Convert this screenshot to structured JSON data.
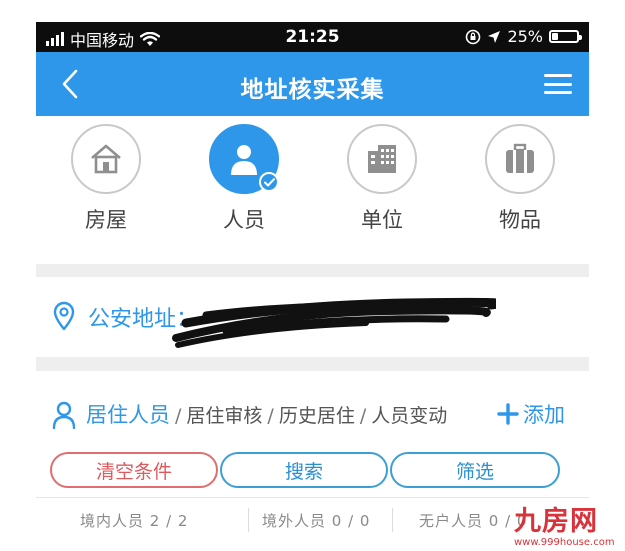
{
  "status_bar": {
    "carrier": "中国移动",
    "time": "21:25",
    "battery_percent": "25%",
    "battery_level": 0.25
  },
  "header": {
    "title": "地址核实采集"
  },
  "categories": [
    {
      "label": "房屋",
      "icon": "house-icon",
      "active": false
    },
    {
      "label": "人员",
      "icon": "person-icon",
      "active": true
    },
    {
      "label": "单位",
      "icon": "building-icon",
      "active": false
    },
    {
      "label": "物品",
      "icon": "items-icon",
      "active": false
    }
  ],
  "address": {
    "label": "公安地址："
  },
  "residents": {
    "tabs": [
      {
        "label": "居住人员",
        "active": true
      },
      {
        "label": "居住审核",
        "active": false
      },
      {
        "label": "历史居住",
        "active": false
      },
      {
        "label": "人员变动",
        "active": false
      }
    ],
    "separator": "/",
    "add_label": "添加"
  },
  "actions": {
    "clear": "清空条件",
    "search": "搜索",
    "filter": "筛选"
  },
  "counts": [
    {
      "label": "境内人员 2 / 2"
    },
    {
      "label": "境外人员 0 / 0"
    },
    {
      "label": "无户人员 0 / 0"
    }
  ],
  "watermark": {
    "brand": "九房网",
    "url": "www.999house.com"
  },
  "colors": {
    "primary": "#2e97ea",
    "danger": "#de5a5d",
    "inactive_border": "#c9c9c9"
  }
}
